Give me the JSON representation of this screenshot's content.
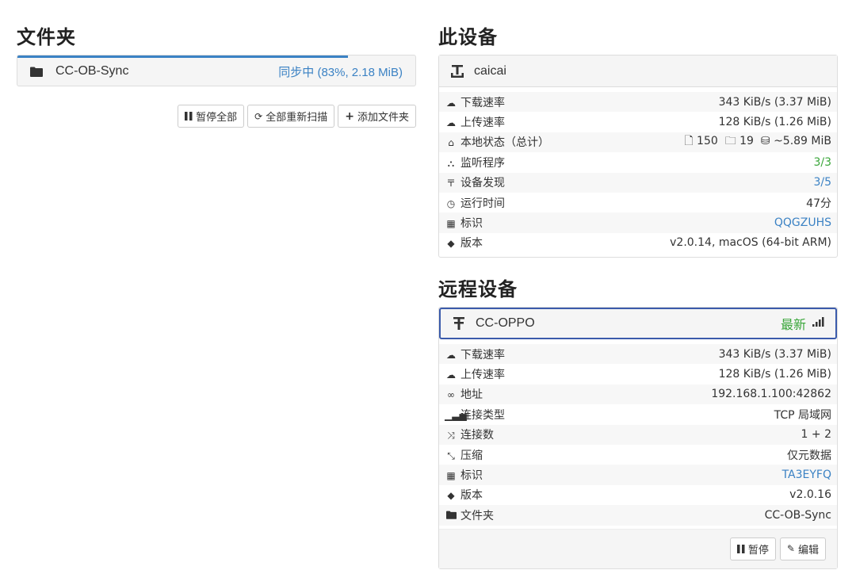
{
  "folders": {
    "title": "文件夹",
    "item": {
      "name": "CC-OB-Sync",
      "status": "同步中 (83%, 2.18 MiB)",
      "progress_fraction": 0.83
    },
    "buttons": {
      "pause_all": "暂停全部",
      "rescan_all": "全部重新扫描",
      "add_folder": "添加文件夹"
    }
  },
  "this_device": {
    "title": "此设备",
    "name": "caicai",
    "rows": [
      {
        "icon": "cloud-download-icon",
        "label": "下载速率",
        "value": "343 KiB/s (3.37 MiB)"
      },
      {
        "icon": "cloud-upload-icon",
        "label": "上传速率",
        "value": "128 KiB/s (1.26 MiB)"
      },
      {
        "icon": "home-icon",
        "label": "本地状态（总计）",
        "files": "150",
        "dirs": "19",
        "size": "~5.89 MiB"
      },
      {
        "icon": "sitemap-icon",
        "label": "监听程序",
        "value": "3/3"
      },
      {
        "icon": "discovery-icon",
        "label": "设备发现",
        "value": "3/5"
      },
      {
        "icon": "clock-icon",
        "label": "运行时间",
        "value": "47分"
      },
      {
        "icon": "qrcode-icon",
        "label": "标识",
        "value": "QQGZUHS"
      },
      {
        "icon": "tag-icon",
        "label": "版本",
        "value": "v2.0.14, macOS (64-bit ARM)"
      }
    ]
  },
  "remote_devices": {
    "title": "远程设备",
    "name": "CC-OPPO",
    "status": "最新",
    "rows": [
      {
        "icon": "cloud-download-icon",
        "label": "下载速率",
        "value": "343 KiB/s (3.37 MiB)"
      },
      {
        "icon": "cloud-upload-icon",
        "label": "上传速率",
        "value": "128 KiB/s (1.26 MiB)"
      },
      {
        "icon": "link-icon",
        "label": "地址",
        "value": "192.168.1.100:42862"
      },
      {
        "icon": "signal-icon",
        "label": "连接类型",
        "value": "TCP 局域网"
      },
      {
        "icon": "random-icon",
        "label": "连接数",
        "value": "1 + 2"
      },
      {
        "icon": "compress-icon",
        "label": "压缩",
        "value": "仅元数据"
      },
      {
        "icon": "qrcode-icon",
        "label": "标识",
        "value": "TA3EYFQ"
      },
      {
        "icon": "tag-icon",
        "label": "版本",
        "value": "v2.0.16"
      },
      {
        "icon": "folder-icon",
        "label": "文件夹",
        "value": "CC-OB-Sync"
      }
    ],
    "buttons": {
      "pause": "暂停",
      "edit": "编辑"
    }
  },
  "colors": {
    "accent_blue": "#3b82c4",
    "success_green": "#3aa63a",
    "remote_border": "#3b5bab"
  }
}
